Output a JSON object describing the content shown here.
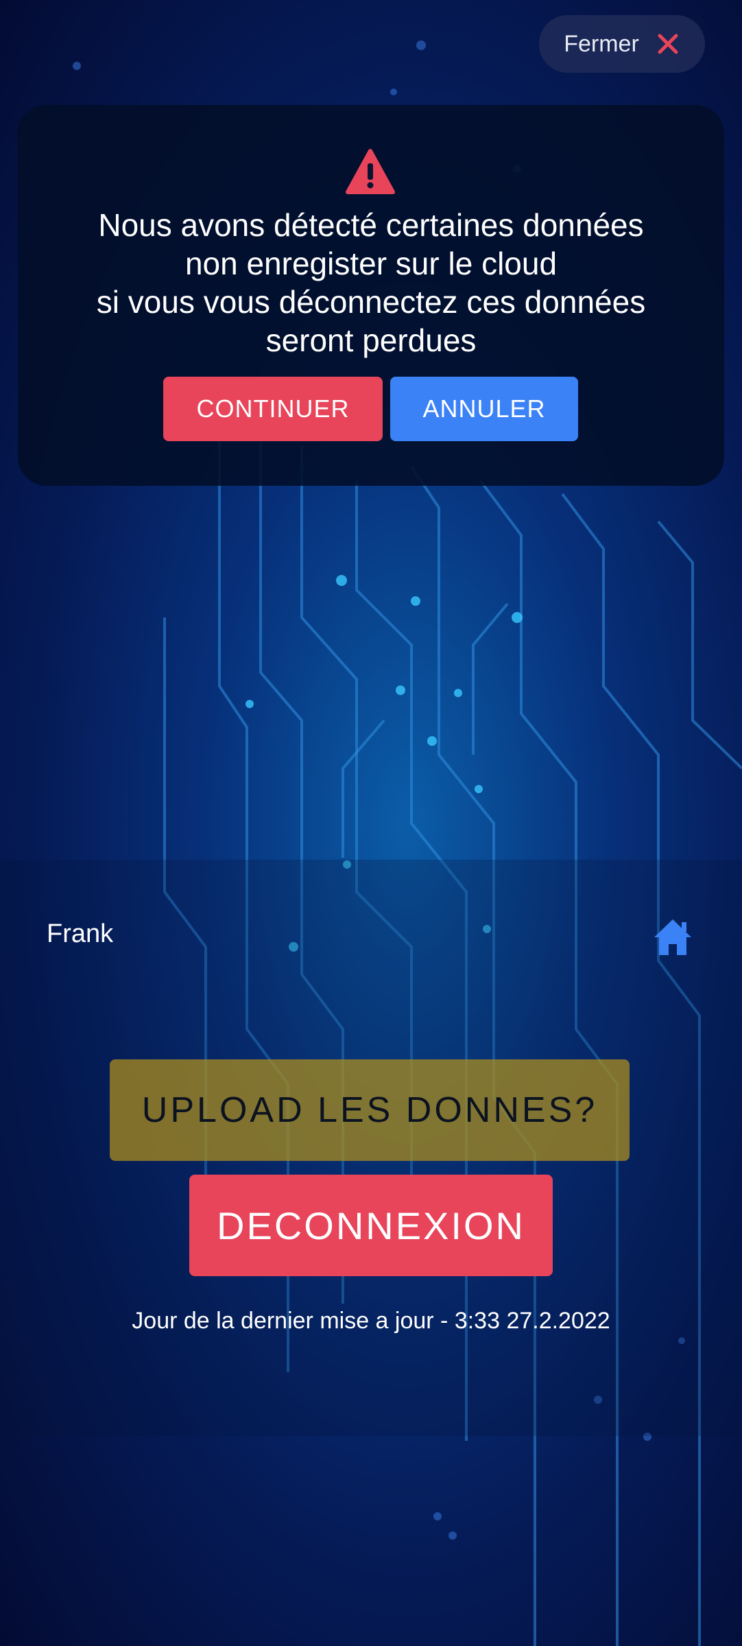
{
  "header": {
    "close_label": "Fermer",
    "close_icon": "close-x-icon"
  },
  "alert": {
    "icon": "warning-triangle-icon",
    "lines": [
      "Nous avons détecté certaines données",
      "non enregister sur le cloud",
      "si vous vous déconnectez ces données",
      "seront perdues"
    ],
    "continue_label": "CONTINUER",
    "cancel_label": "ANNULER"
  },
  "user": {
    "name": "Frank",
    "icon": "home-icon"
  },
  "actions": {
    "upload_label": "UPLOAD LES DONNES?",
    "logout_label": "DECONNEXION"
  },
  "footer": {
    "last_update": "Jour de la dernier mise a jour - 3:33 27.2.2022"
  },
  "colors": {
    "danger": "#e8445a",
    "primary": "#3b82f6",
    "upload": "#ab8c1e",
    "background": "#07307a"
  }
}
